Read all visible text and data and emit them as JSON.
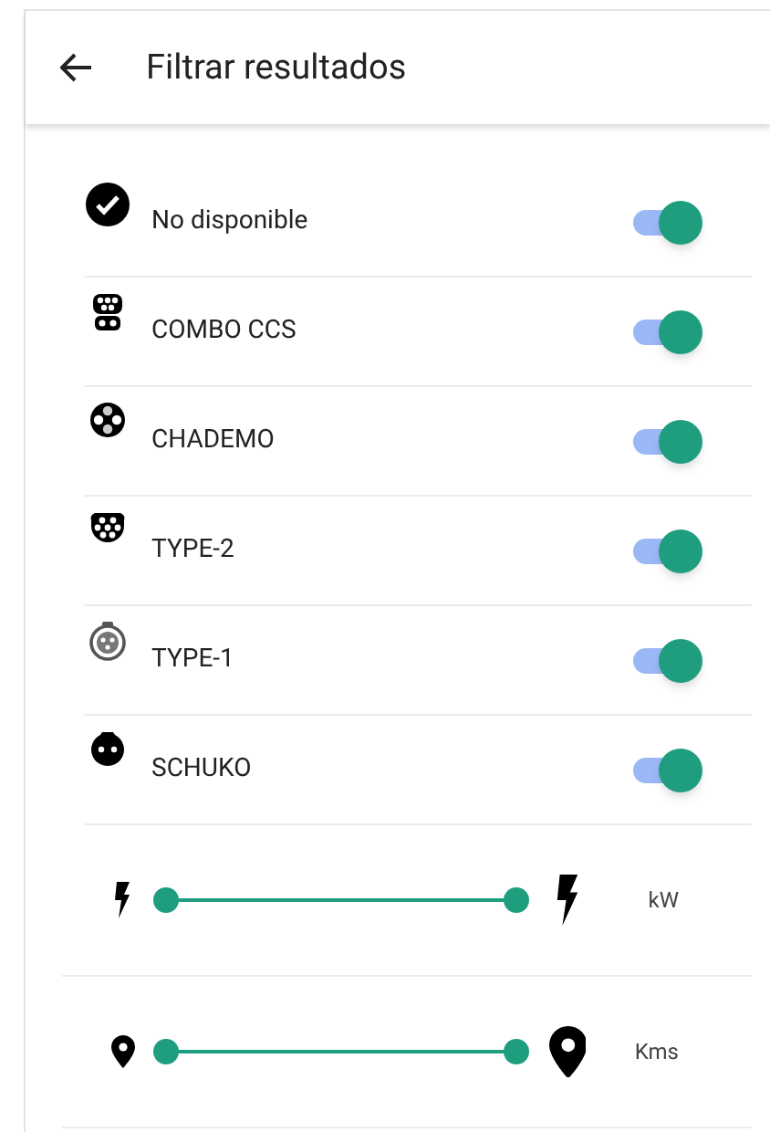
{
  "header": {
    "title": "Filtrar resultados"
  },
  "filters": [
    {
      "label": "No disponible",
      "on": true
    },
    {
      "label": "COMBO CCS",
      "on": true
    },
    {
      "label": "CHADEMO",
      "on": true
    },
    {
      "label": "TYPE-2",
      "on": true
    },
    {
      "label": "TYPE-1",
      "on": true
    },
    {
      "label": "SCHUKO",
      "on": true
    }
  ],
  "ranges": [
    {
      "kind": "power",
      "unit": "kW",
      "thumbs": [
        {
          "level": 0
        },
        {
          "level": 1
        }
      ]
    },
    {
      "kind": "distance",
      "unit": "Kms",
      "thumbs": [
        {
          "level": 0
        },
        {
          "level": 1
        }
      ]
    }
  ]
}
